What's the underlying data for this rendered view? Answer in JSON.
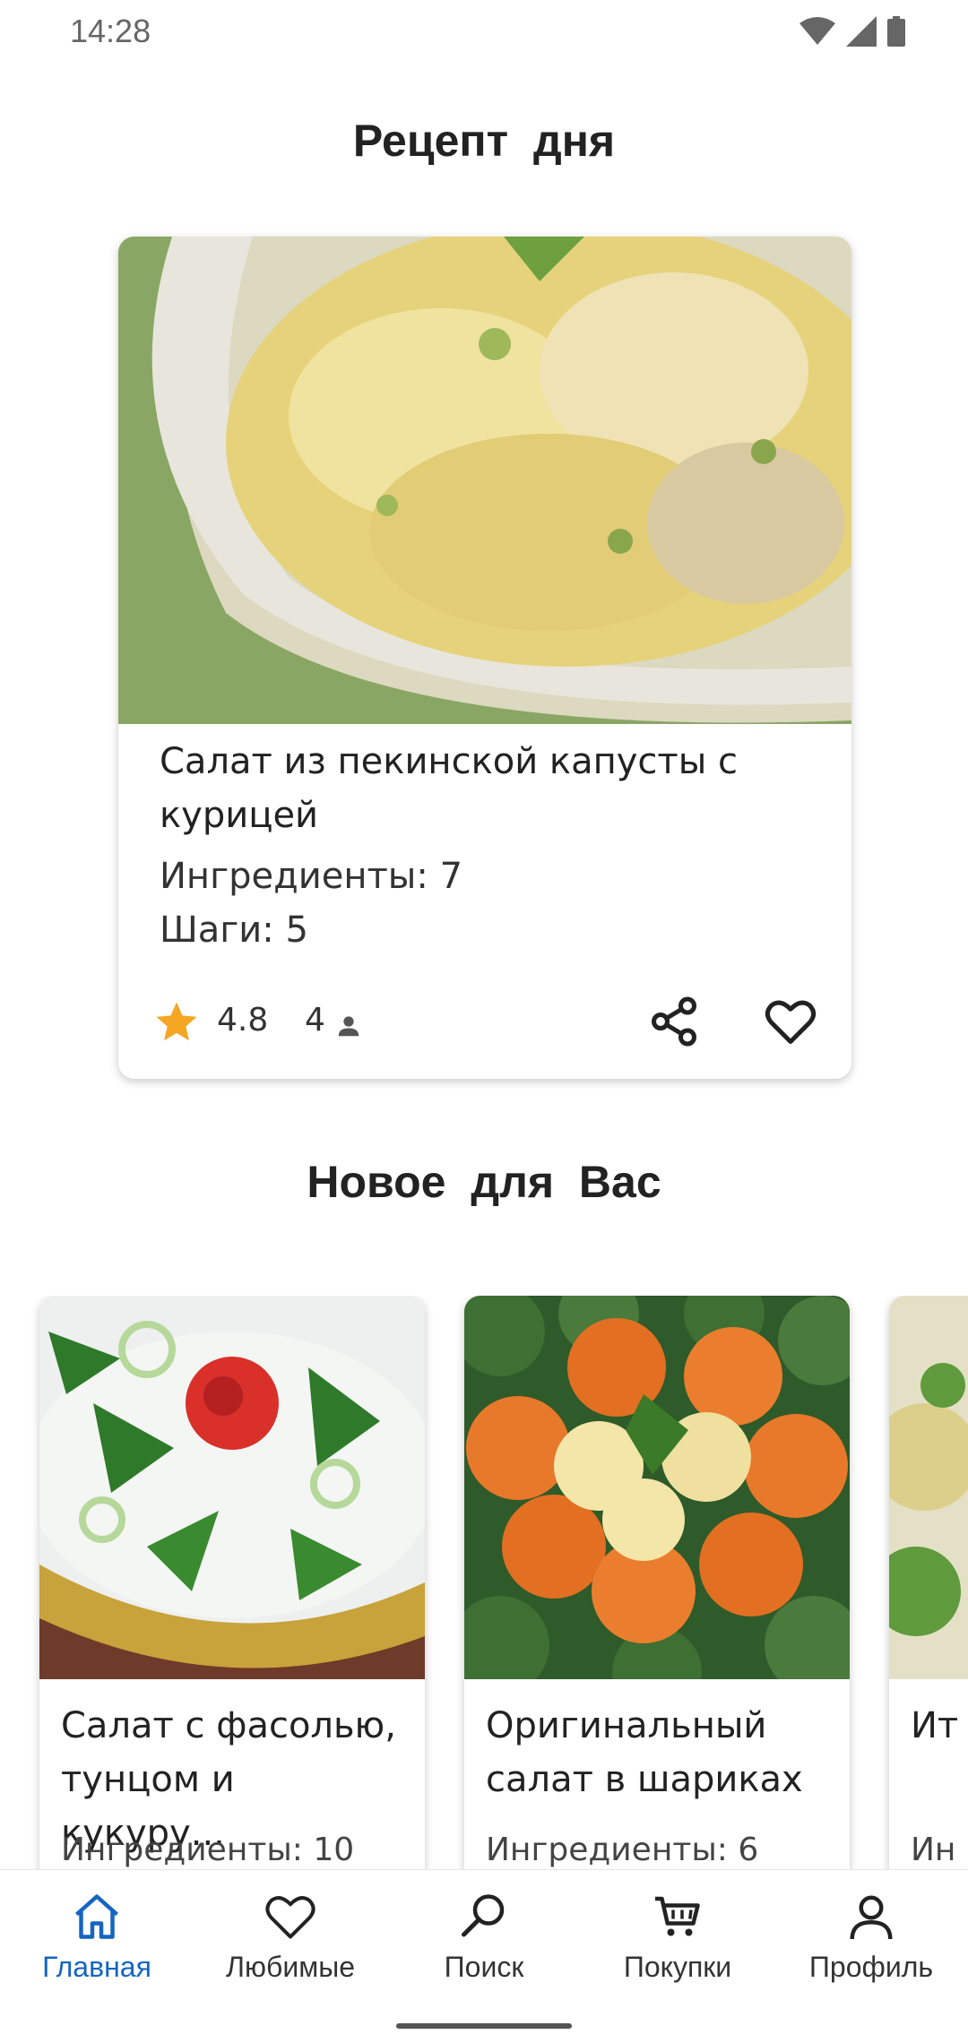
{
  "status": {
    "time": "14:28"
  },
  "recipe_of_day": {
    "heading": "Рецепт дня",
    "title": "Салат из пекинской капусты с курицей",
    "ingredients": "Ингредиенты: 7",
    "steps": "Шаги: 5",
    "rating": "4.8",
    "people": "4"
  },
  "new_for_you": {
    "heading": "Новое для Вас",
    "cards": [
      {
        "title": "Салат с фасолью, тунцом и кукуру...",
        "ingredients": "Ингредиенты: 10"
      },
      {
        "title": "Оригинальный салат в шариках",
        "ingredients": "Ингредиенты: 6"
      },
      {
        "title": "Ит са",
        "ingredients": "Ин"
      }
    ]
  },
  "bottom_nav": [
    {
      "label": "Главная",
      "icon": "home-icon",
      "active": true
    },
    {
      "label": "Любимые",
      "icon": "heart-icon",
      "active": false
    },
    {
      "label": "Поиск",
      "icon": "search-icon",
      "active": false
    },
    {
      "label": "Покупки",
      "icon": "cart-icon",
      "active": false
    },
    {
      "label": "Профиль",
      "icon": "profile-icon",
      "active": false
    }
  ],
  "colors": {
    "accent": "#1565c0",
    "star": "#f5a623"
  }
}
